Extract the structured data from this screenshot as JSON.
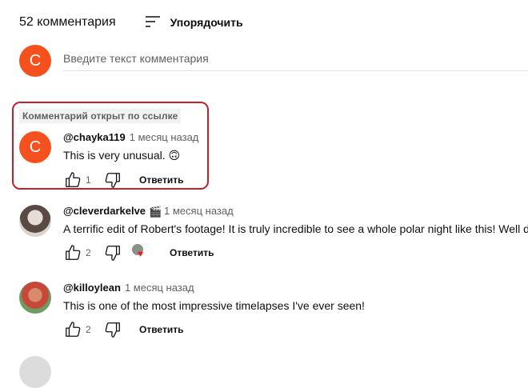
{
  "header": {
    "comment_count": "52 комментария",
    "sort_label": "Упорядочить"
  },
  "add_comment": {
    "avatar_letter": "C",
    "placeholder": "Введите текст комментария"
  },
  "linked_label": "Комментарий открыт по ссылке",
  "comments": [
    {
      "avatar_letter": "C",
      "handle": "@chayka119",
      "time": "1 месяц назад",
      "text": "This is very unusual. 🙃",
      "likes": "1",
      "reply": "Ответить"
    },
    {
      "handle": "@cleverdarkelve",
      "badge": "🎬",
      "time": "1 месяц назад",
      "text": "A terrific edit of Robert's footage! It is truly incredible to see a whole polar night like this! Well done",
      "likes": "2",
      "reply": "Ответить"
    },
    {
      "handle": "@killoylean",
      "time": "1 месяц назад",
      "text": "This is one of the most impressive timelapses I've ever seen!",
      "likes": "2",
      "reply": "Ответить"
    }
  ],
  "colors": {
    "accent_avatar": "#f4511e",
    "highlight_border": "#c4202a",
    "heart": "#e62117"
  }
}
